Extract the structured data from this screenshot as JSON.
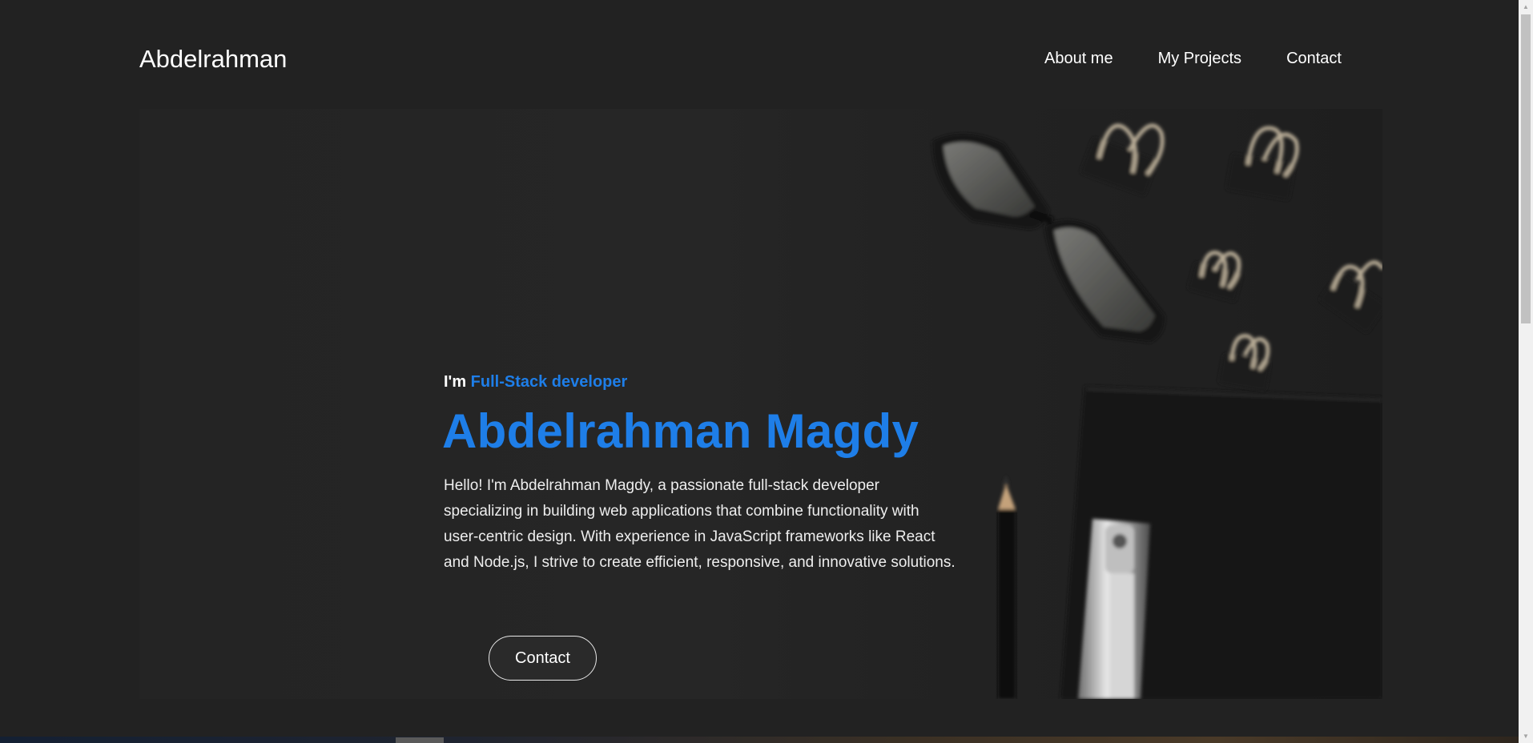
{
  "nav": {
    "brand": "Abdelrahman",
    "links": [
      "About me",
      "My Projects",
      "Contact"
    ]
  },
  "hero": {
    "intro_prefix": "I'm",
    "intro_role": "Full-Stack developer",
    "headline": "Abdelrahman Magdy",
    "bio": "Hello! I'm Abdelrahman Magdy, a passionate full-stack developer specializing in building web applications that combine functionality with user-centric design. With experience in JavaScript frameworks like React and Node.js, I strive to create efficient, responsive, and innovative solutions.",
    "contact_button": "Contact",
    "art_icons": [
      "glasses-icon",
      "binder-clip-icon",
      "pencil-icon",
      "notebook-icon"
    ]
  },
  "colors": {
    "background": "#222222",
    "accent": "#1e7ee8",
    "text": "#ffffff"
  }
}
